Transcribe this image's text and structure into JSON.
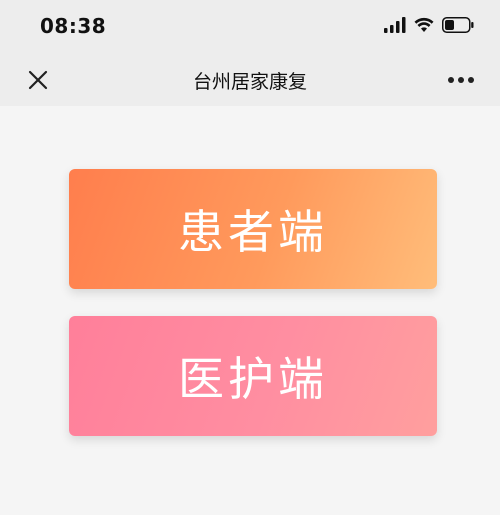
{
  "status_bar": {
    "time": "08:38"
  },
  "nav": {
    "title": "台州居家康复",
    "close_icon": "close-icon",
    "more_icon": "more-icon"
  },
  "buttons": {
    "patient_label": "患者端",
    "medical_label": "医护端"
  },
  "colors": {
    "patient_gradient_start": "#ff7e4d",
    "patient_gradient_end": "#ffbd7a",
    "medical_gradient_start": "#ff7f9a",
    "medical_gradient_end": "#ff9f9e",
    "bar_background": "#ededed",
    "page_background": "#f5f5f5"
  }
}
